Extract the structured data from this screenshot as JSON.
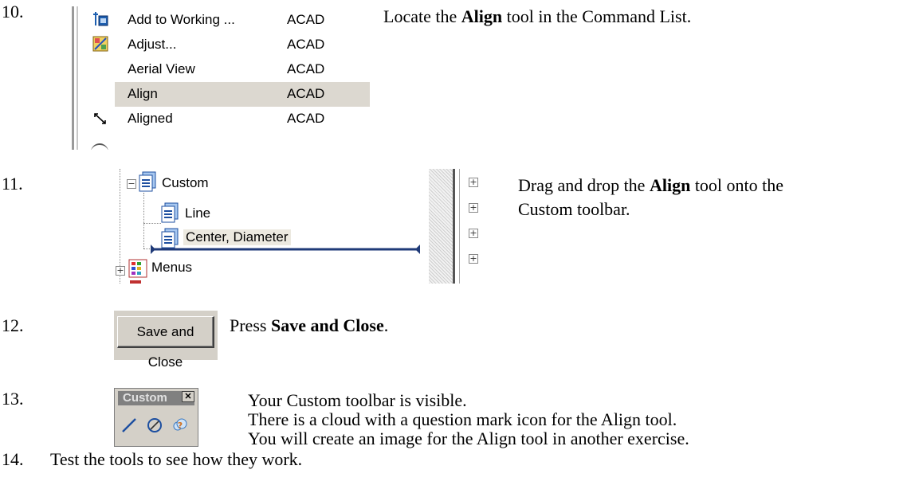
{
  "steps": [
    {
      "number": "10.",
      "text_pre": "Locate the ",
      "text_bold": "Align",
      "text_post": " tool in the Command List.",
      "command_list": [
        {
          "name": "Add to Working ...",
          "source": "ACAD",
          "icon": "add-to-working-icon",
          "selected": false
        },
        {
          "name": "Adjust...",
          "source": "ACAD",
          "icon": "adjust-icon",
          "selected": false
        },
        {
          "name": "Aerial View",
          "source": "ACAD",
          "icon": "",
          "selected": false
        },
        {
          "name": "Align",
          "source": "ACAD",
          "icon": "",
          "selected": true
        },
        {
          "name": "Aligned",
          "source": "ACAD",
          "icon": "aligned-dimension-icon",
          "selected": false
        }
      ]
    },
    {
      "number": "11.",
      "line1_pre": "Drag and drop the ",
      "line1_bold": "Align",
      "line1_post": " tool onto the",
      "line2": "Custom toolbar.",
      "tree": {
        "custom": "Custom",
        "line": "Line",
        "center": "Center, Diameter",
        "menus": "Menus"
      }
    },
    {
      "number": "12.",
      "text_pre": "Press ",
      "text_bold": "Save and Close",
      "text_post": ".",
      "button_label": "Save and Close"
    },
    {
      "number": "13.",
      "lines": [
        "Your Custom toolbar is visible.",
        "There is a cloud with a question mark icon for the Align tool.",
        "You will create an image for the Align tool in another exercise."
      ],
      "toolbar_title": "Custom",
      "toolbar_close": "✕",
      "toolbar_buttons": [
        "line-tool-icon",
        "circle-diameter-icon",
        "cloud-question-icon"
      ]
    },
    {
      "number": "14.",
      "text": "Test the tools to see how they work."
    }
  ],
  "colors": {
    "selection": "#dcd8d0",
    "drop_indicator": "#1f3a78",
    "toolbar_bg": "#d4d0c8",
    "toolbar_title_bg": "#808080"
  }
}
